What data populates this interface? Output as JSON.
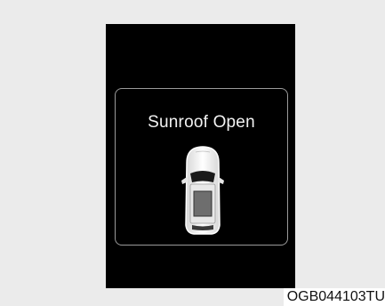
{
  "display": {
    "message": "Sunroof Open",
    "icon": "car-top-view-sunroof-icon"
  },
  "caption": {
    "code": "OGB044103TU"
  },
  "colors": {
    "page_background": "#ebebeb",
    "screen_background": "#000000",
    "frame_border": "#9a9a9a",
    "text": "#f2f2f2"
  }
}
